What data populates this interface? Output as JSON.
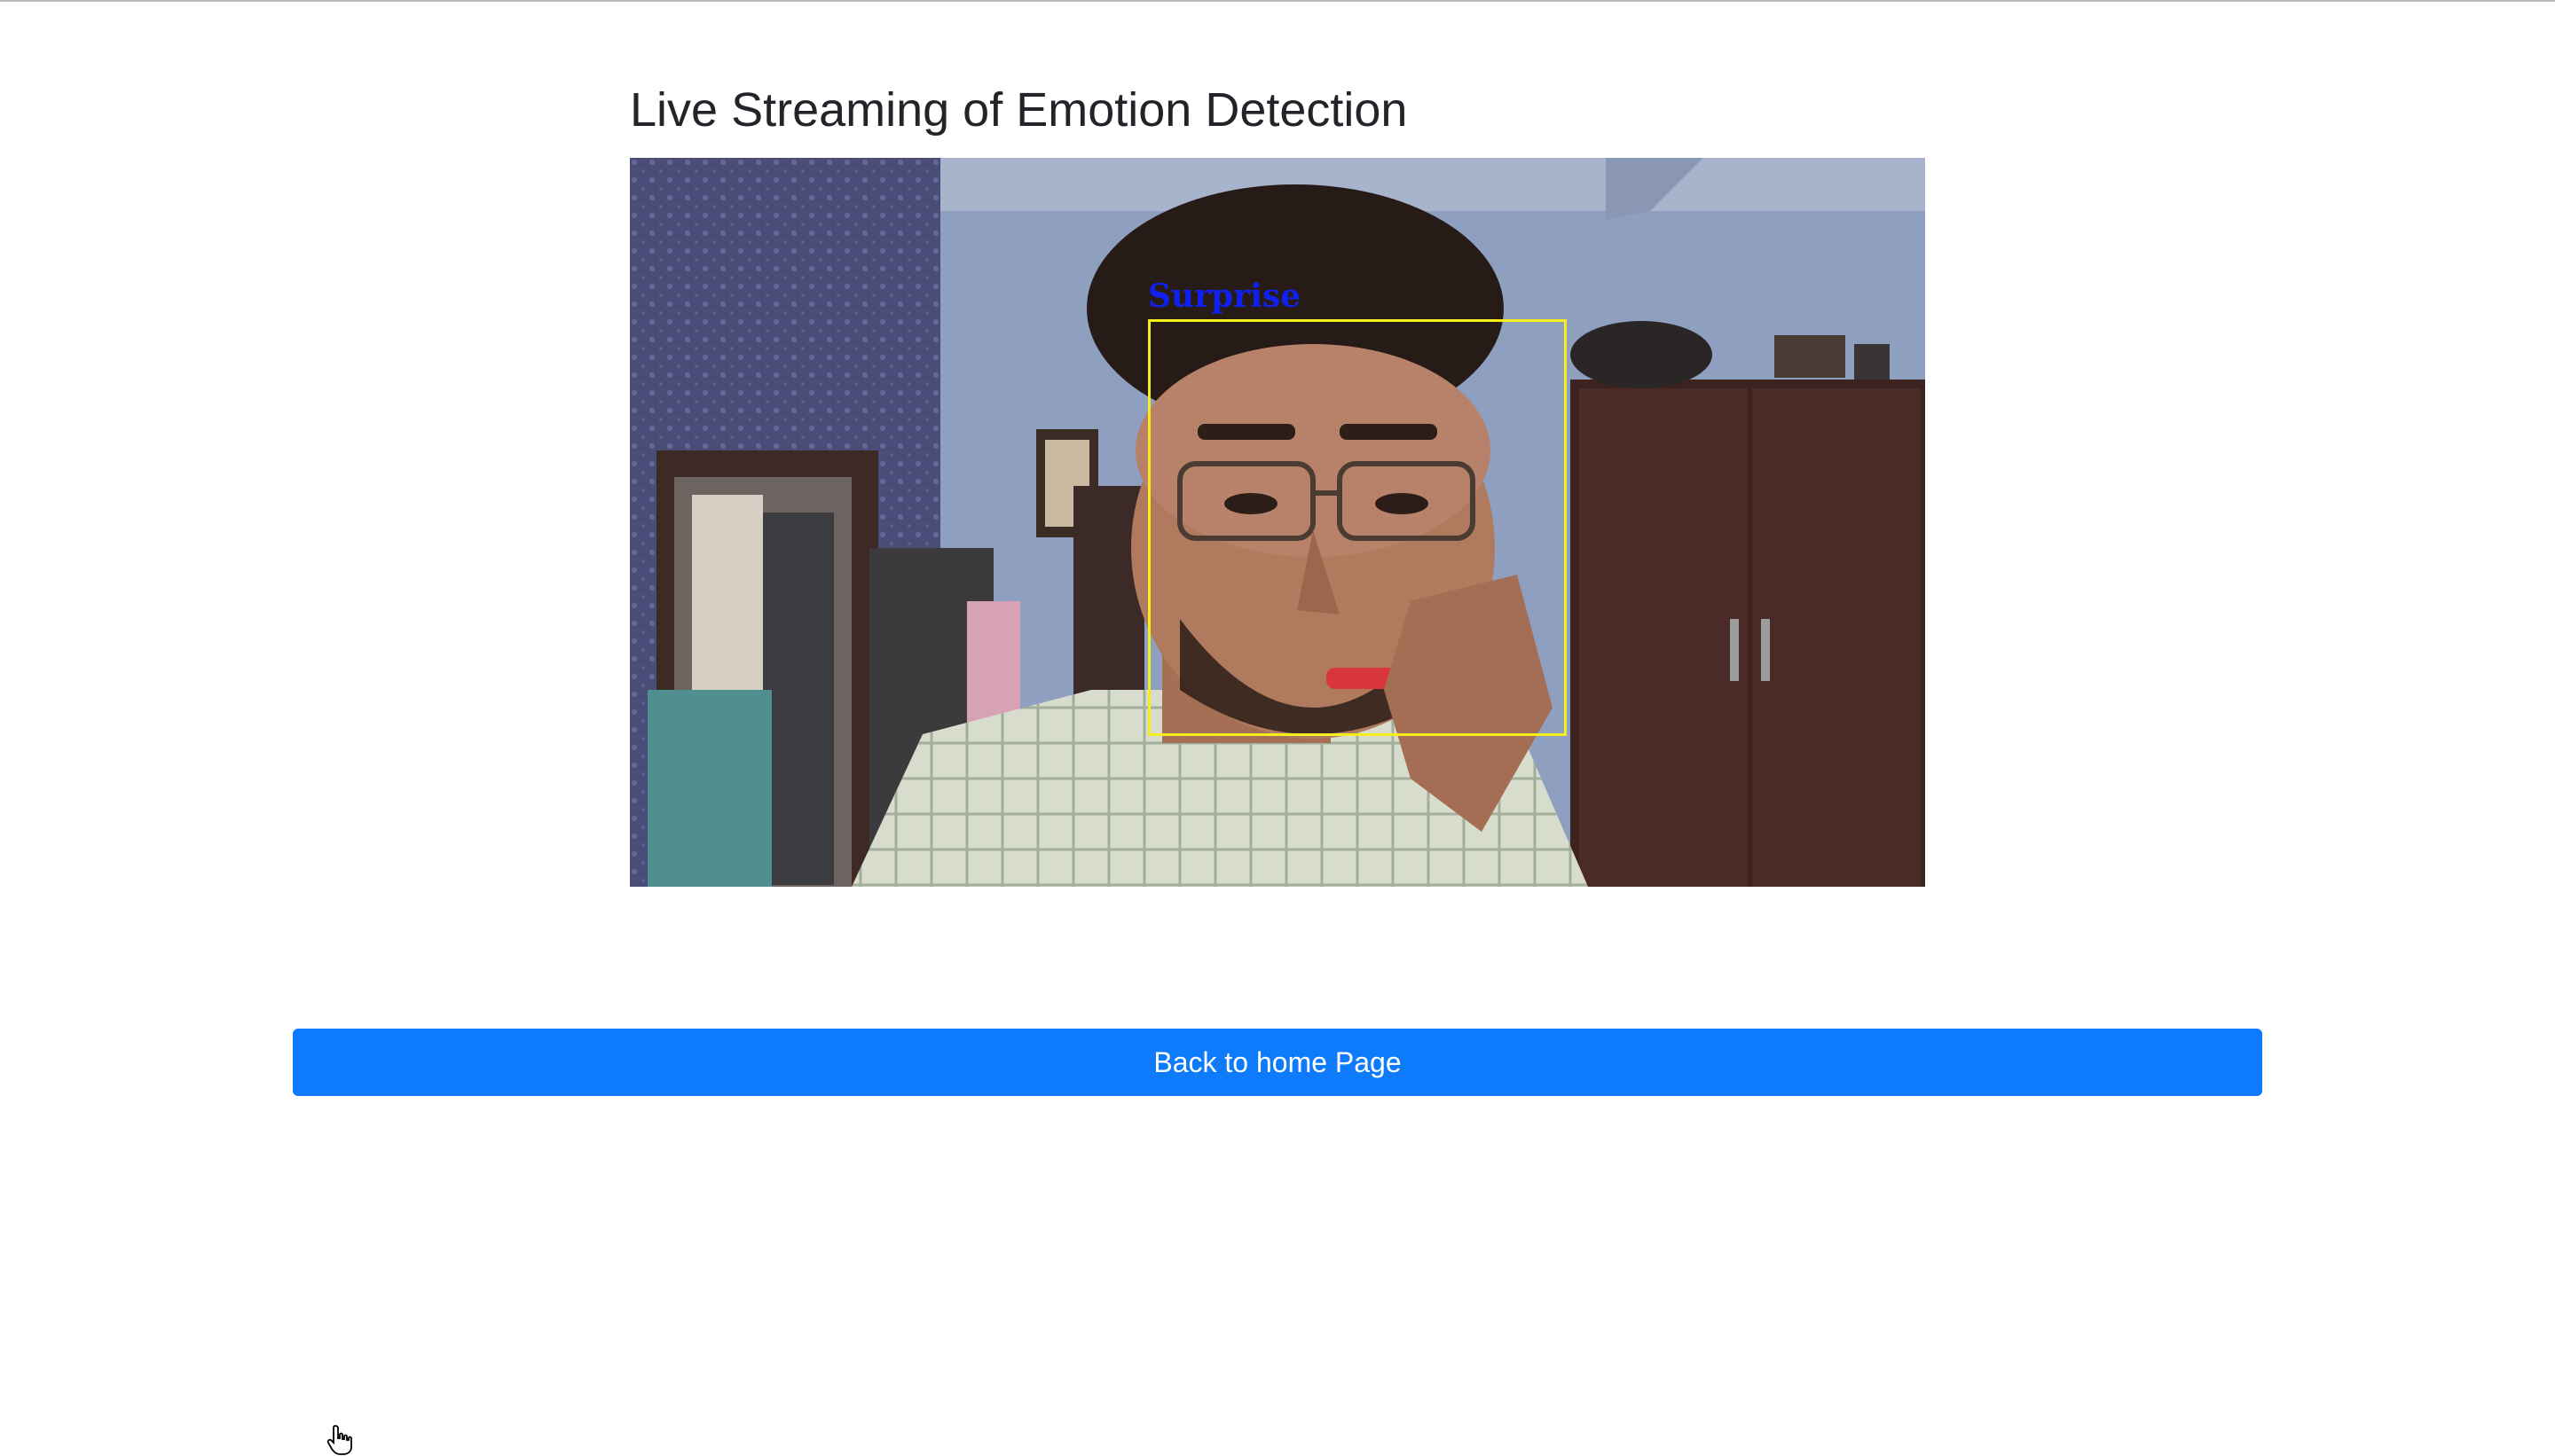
{
  "page": {
    "title": "Live Streaming of Emotion Detection"
  },
  "video": {
    "detection": {
      "emotion_label": "Surprise",
      "box_color": "#f4ef1c",
      "label_color": "#1020ee"
    }
  },
  "actions": {
    "home_button_label": "Back to home Page",
    "home_button_color": "#0d7bfb"
  },
  "cursor": {
    "icon": "hand-pointer-icon"
  }
}
